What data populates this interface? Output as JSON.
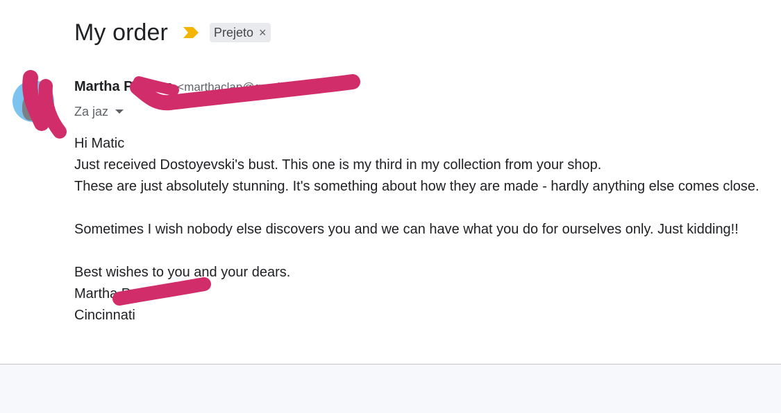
{
  "message": {
    "subject": "My order",
    "importance_icon": "importance-marker-icon",
    "label": "Prejeto",
    "label_remove": "×",
    "sender_name": "Martha Powers",
    "sender_email": "<marthaclap@gmail.com>",
    "recipient": "Za jaz",
    "body_lines": [
      "Hi Matic",
      "Just received Dostoyevski's bust. This one is my third in my collection from your shop.",
      "These are just absolutely stunning. It's something about how they are made - hardly anything else comes close.",
      "",
      "Sometimes I wish nobody else discovers you and we can have what you do for ourselves only. Just kidding!!",
      "",
      "Best wishes to you and your dears.",
      "Martha P",
      "Cincinnati"
    ]
  },
  "colors": {
    "importance": "#f4b400",
    "redaction": "#d12d6b",
    "avatar_bg": "#7cc3f0"
  }
}
